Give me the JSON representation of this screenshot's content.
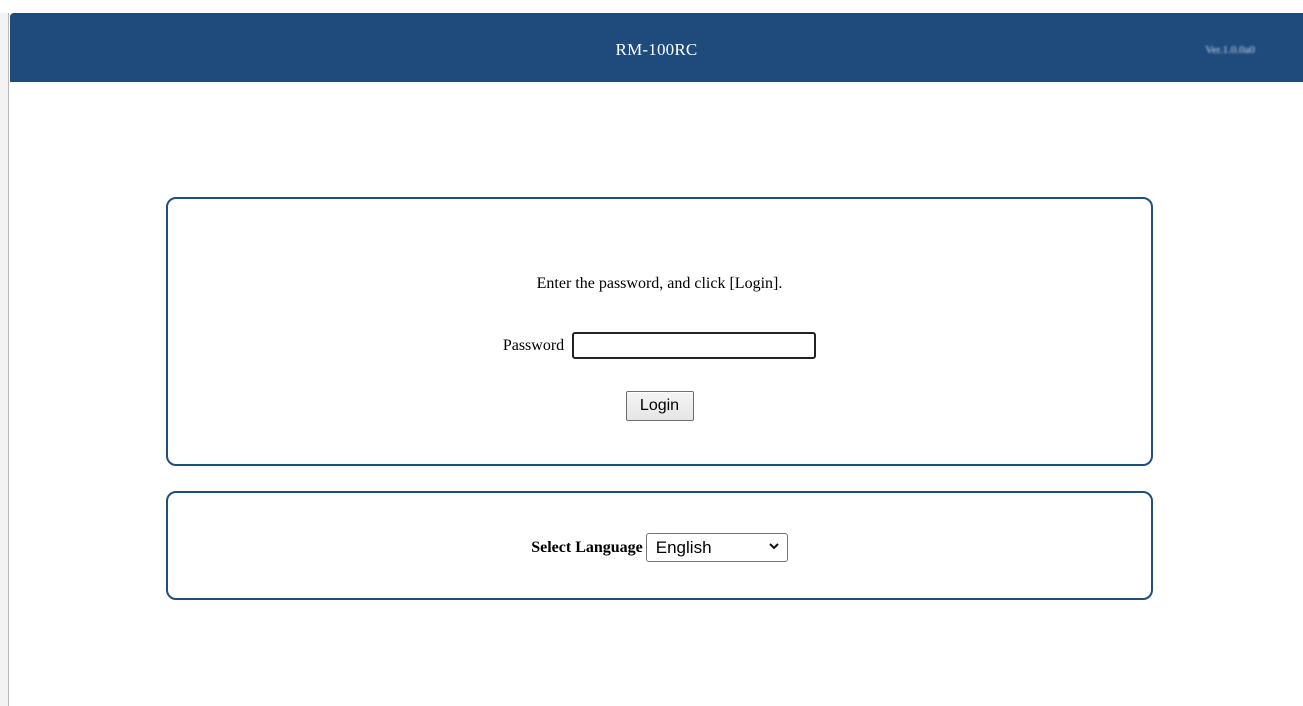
{
  "header": {
    "title": "RM-100RC",
    "version": "Ver.1.0.0a0"
  },
  "login": {
    "instruction": "Enter the password, and click [Login].",
    "password_label": "Password",
    "password_value": "",
    "login_button": "Login"
  },
  "language": {
    "label": "Select Language",
    "selected": "English"
  },
  "colors": {
    "header_background": "#1e4a7c",
    "panel_border": "#214f7c"
  },
  "icons": {
    "dropdown": "chevron-down-icon"
  }
}
